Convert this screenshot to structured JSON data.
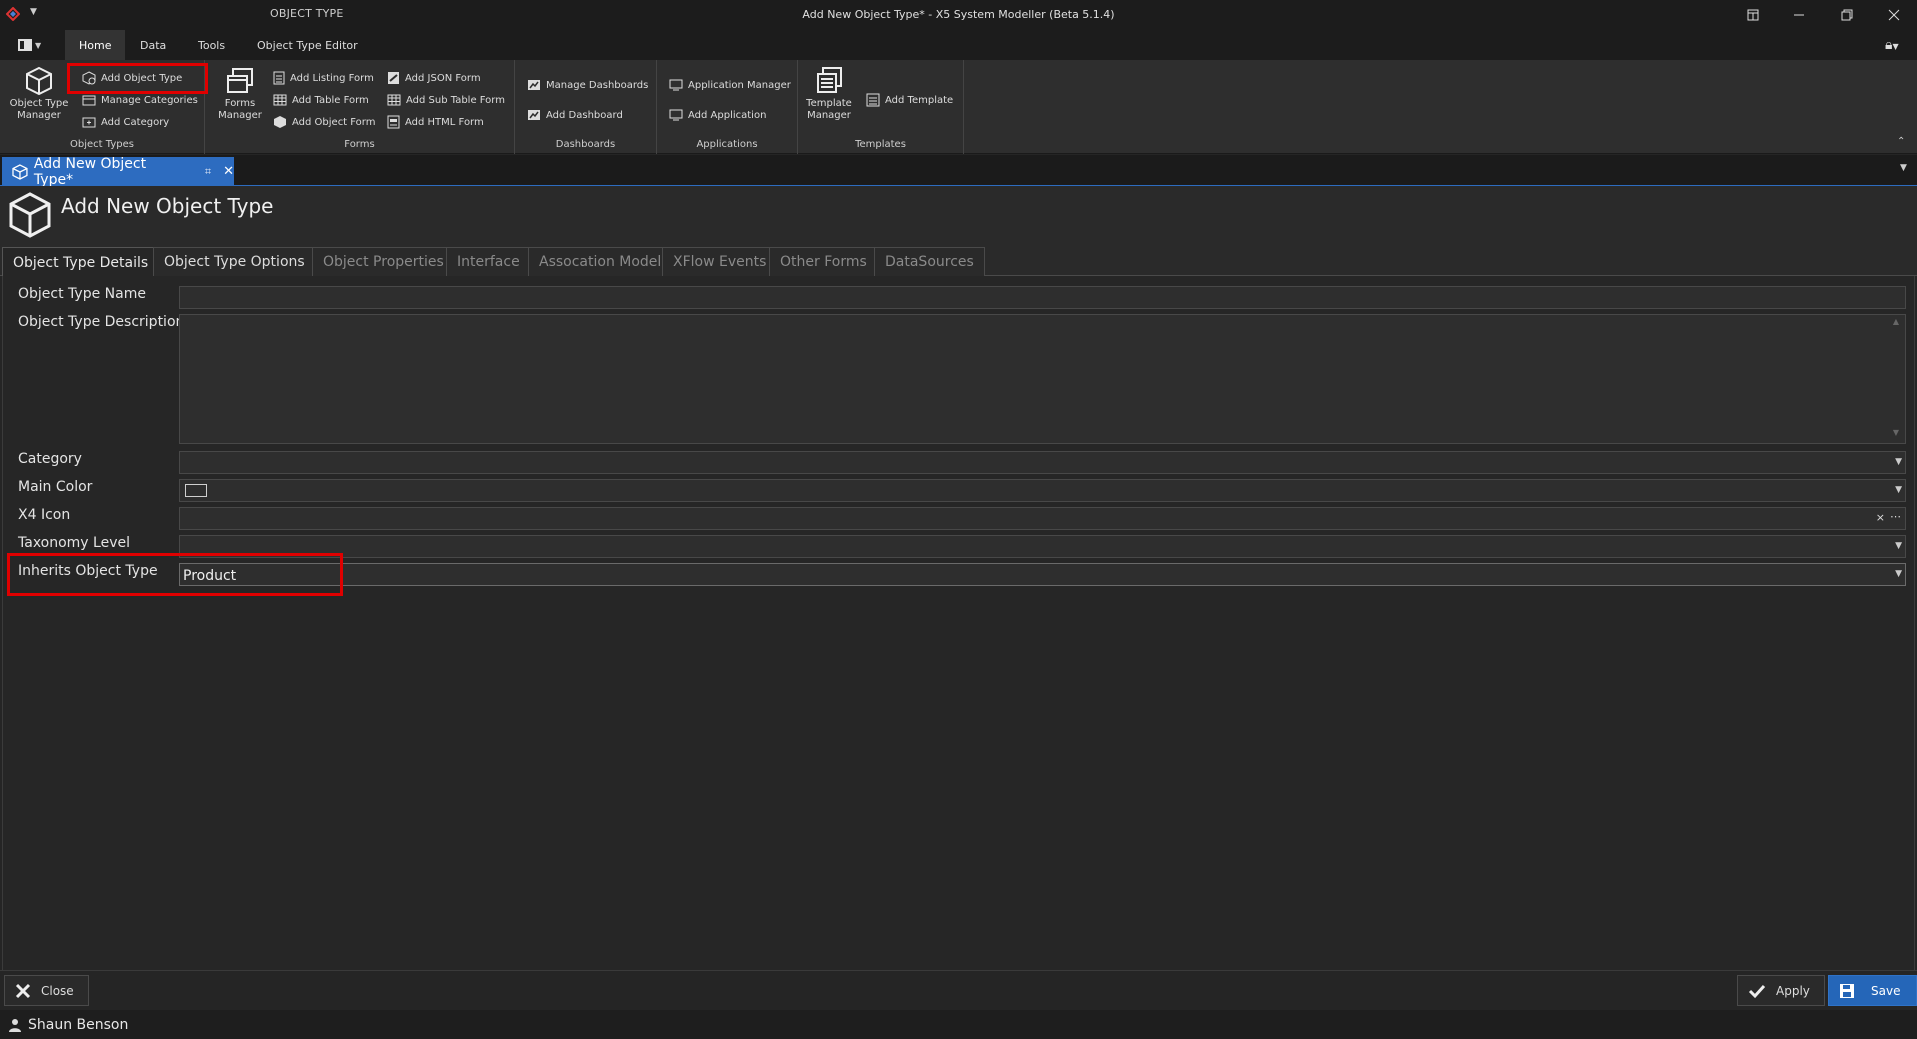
{
  "titlebar": {
    "context_title": "OBJECT TYPE",
    "window_title": "Add New Object Type* - X5 System Modeller (Beta 5.1.4)"
  },
  "menu": {
    "tabs": [
      {
        "label": "Home",
        "active": true
      },
      {
        "label": "Data"
      },
      {
        "label": "Tools"
      },
      {
        "label": "Object Type Editor"
      }
    ]
  },
  "ribbon": {
    "object_types": {
      "label": "Object Types",
      "big_button": "Object Type Manager",
      "items": [
        "Add Object Type",
        "Manage Categories",
        "Add Category"
      ]
    },
    "forms": {
      "label": "Forms",
      "big_button": "Forms Manager",
      "col1": [
        "Add Listing Form",
        "Add Table Form",
        "Add Object Form"
      ],
      "col2": [
        "Add JSON Form",
        "Add Sub Table Form",
        "Add HTML Form"
      ]
    },
    "dashboards": {
      "label": "Dashboards",
      "items": [
        "Manage Dashboards",
        "Add Dashboard"
      ]
    },
    "applications": {
      "label": "Applications",
      "items": [
        "Application Manager",
        "Add Application"
      ]
    },
    "templates": {
      "label": "Templates",
      "big_button": "Template Manager",
      "items": [
        "Add Template"
      ]
    }
  },
  "document_tab": {
    "label": "Add New Object Type*"
  },
  "header": {
    "title": "Add New Object Type"
  },
  "form_tabs": [
    {
      "label": "Object Type Details",
      "state": "active"
    },
    {
      "label": "Object Type Options",
      "state": "enabled"
    },
    {
      "label": "Object Properties",
      "state": "disabled"
    },
    {
      "label": "Interface",
      "state": "disabled"
    },
    {
      "label": "Assocation Model",
      "state": "disabled"
    },
    {
      "label": "XFlow Events",
      "state": "disabled"
    },
    {
      "label": "Other Forms",
      "state": "disabled"
    },
    {
      "label": "DataSources",
      "state": "disabled"
    }
  ],
  "form": {
    "name_label": "Object Type Name",
    "name_value": "",
    "description_label": "Object Type Description",
    "description_value": "",
    "category_label": "Category",
    "category_value": "",
    "main_color_label": "Main Color",
    "x4_icon_label": "X4 Icon",
    "x4_icon_value": "",
    "taxonomy_label": "Taxonomy Level",
    "taxonomy_value": "",
    "inherits_label": "Inherits Object Type",
    "inherits_value": "Product"
  },
  "footer": {
    "close_label": "Close",
    "apply_label": "Apply",
    "save_label": "Save"
  },
  "status": {
    "user": "Shaun Benson"
  },
  "colors": {
    "accent": "#2d6cc0",
    "highlight": "#e00000",
    "background": "#252525"
  }
}
